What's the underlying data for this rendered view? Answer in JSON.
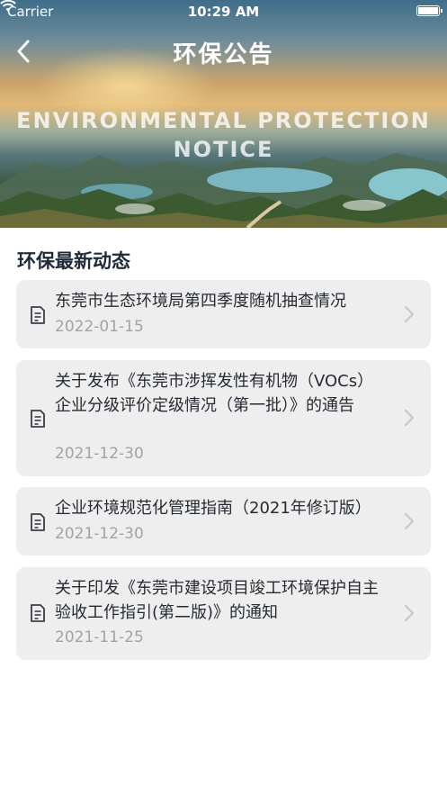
{
  "status_bar": {
    "carrier": "Carrier",
    "time": "10:29 AM"
  },
  "header": {
    "title": "环保公告",
    "banner_line1": "ENVIRONMENTAL PROTECTION",
    "banner_line2": "NOTICE"
  },
  "section": {
    "title": "环保最新动态"
  },
  "notices": [
    {
      "title": "东莞市生态环境局第四季度随机抽查情况",
      "date": "2022-01-15"
    },
    {
      "title": "关于发布《东莞市涉挥发性有机物（VOCs）企业分级评价定级情况（第一批）》的通告",
      "date": "2021-12-30"
    },
    {
      "title": "企业环境规范化管理指南（2021年修订版）",
      "date": "2021-12-30"
    },
    {
      "title": "关于印发《东莞市建设项目竣工环境保护自主验收工作指引(第二版)》的通知",
      "date": "2021-11-25"
    }
  ],
  "icons": {
    "back": "chevron-left-icon",
    "document": "document-icon",
    "chevron": "chevron-right-icon"
  }
}
